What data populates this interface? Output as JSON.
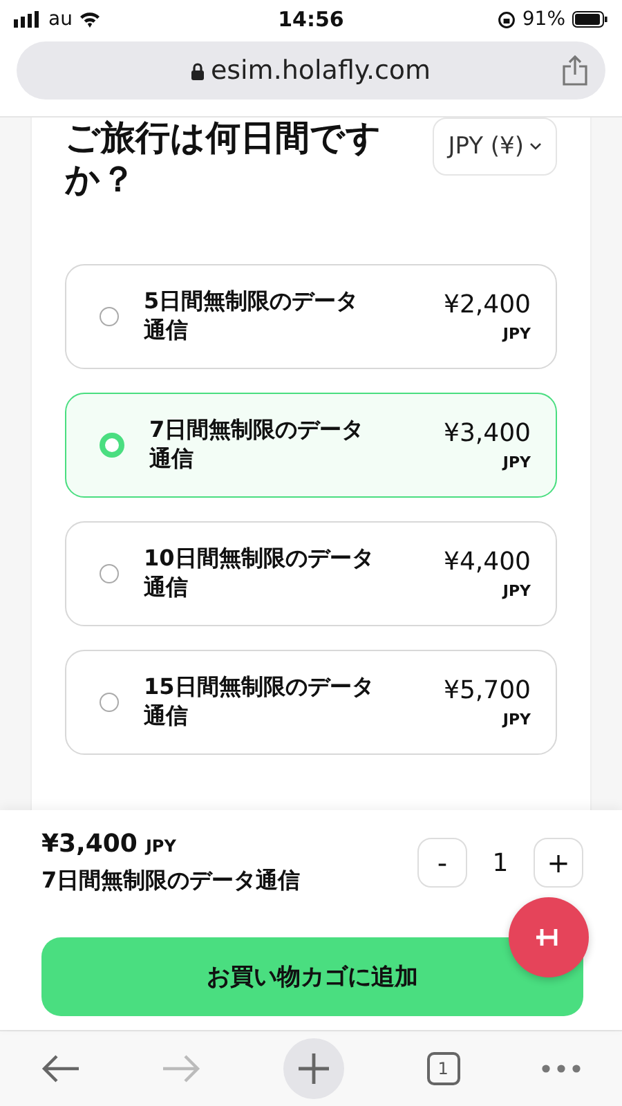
{
  "status_bar": {
    "carrier": "au",
    "time": "14:56",
    "battery": "91%"
  },
  "url_bar": {
    "url": "esim.holafly.com"
  },
  "heading": "ご旅行は何日間ですか？",
  "currency_select": {
    "value": "JPY (¥)"
  },
  "plans": [
    {
      "name": "5日間無制限のデータ通信",
      "price": "¥2,400",
      "currency": "JPY",
      "selected": false
    },
    {
      "name": "7日間無制限のデータ通信",
      "price": "¥3,400",
      "currency": "JPY",
      "selected": true
    },
    {
      "name": "10日間無制限のデータ通信",
      "price": "¥4,400",
      "currency": "JPY",
      "selected": false
    },
    {
      "name": "15日間無制限のデータ通信",
      "price": "¥5,700",
      "currency": "JPY",
      "selected": false
    }
  ],
  "cart": {
    "price": "¥3,400",
    "currency": "JPY",
    "name": "7日間無制限のデータ通信",
    "decrement": "-",
    "quantity": "1",
    "increment": "+",
    "add_button": "お買い物カゴに追加"
  },
  "toolbar": {
    "tab_count": "1"
  }
}
